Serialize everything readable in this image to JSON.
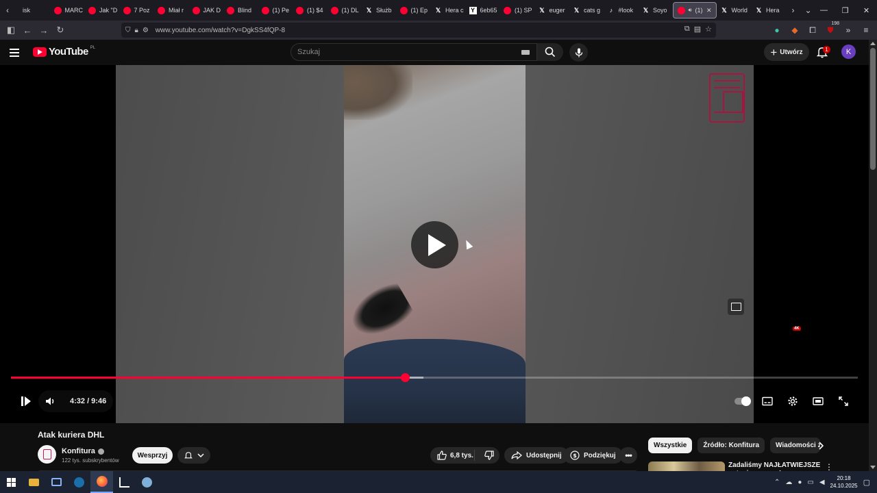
{
  "browser": {
    "tabs": [
      {
        "label": "isk",
        "favicon": "none"
      },
      {
        "label": "MARC",
        "favicon": "youtube"
      },
      {
        "label": "Jak \"D",
        "favicon": "youtube"
      },
      {
        "label": "7 Poz",
        "favicon": "youtube"
      },
      {
        "label": "Miał r",
        "favicon": "youtube"
      },
      {
        "label": "JAK D",
        "favicon": "youtube"
      },
      {
        "label": "Blind",
        "favicon": "youtube"
      },
      {
        "label": "(1) Pe",
        "favicon": "youtube"
      },
      {
        "label": "(1) $4",
        "favicon": "youtube"
      },
      {
        "label": "(1) DL",
        "favicon": "youtube"
      },
      {
        "label": "Służb",
        "favicon": "x"
      },
      {
        "label": "(1) Ep",
        "favicon": "youtube"
      },
      {
        "label": "Hera c",
        "favicon": "x"
      },
      {
        "label": "6eb65",
        "favicon": "y-square"
      },
      {
        "label": "(1) SP",
        "favicon": "youtube"
      },
      {
        "label": "euger",
        "favicon": "x"
      },
      {
        "label": "cats g",
        "favicon": "x"
      },
      {
        "label": "#look",
        "favicon": "tiktok"
      },
      {
        "label": "Soyo",
        "favicon": "x"
      },
      {
        "label": "(1)",
        "favicon": "youtube",
        "active": true
      },
      {
        "label": "World",
        "favicon": "x"
      },
      {
        "label": "Hera",
        "favicon": "x"
      }
    ],
    "url": "www.youtube.com/watch?v=DgkSS4fQP-8",
    "extension_badge": "198"
  },
  "youtube": {
    "logo_text": "YouTube",
    "region": "PL",
    "search_placeholder": "Szukaj",
    "create_label": "Utwórz",
    "notifications_count": "1",
    "avatar_letter": "K"
  },
  "player": {
    "current_time": "4:32",
    "duration": "9:46",
    "time_display": "4:32 / 9:46",
    "played_fraction": 0.465,
    "loaded_fraction": 0.487,
    "quality_badge": "4K"
  },
  "video": {
    "title": "Atak kuriera DHL",
    "channel_name": "Konfitura",
    "subscribers": "122 tys. subskrybentów",
    "support_label": "Wesprzyj",
    "likes": "6,8 tys.",
    "share_label": "Udostępnij",
    "thanks_label": "Podziękuj"
  },
  "sidebar": {
    "chips": [
      "Wszystkie",
      "Źródło: Konfitura",
      "Wiadomości ze"
    ],
    "recommendation_title": "Zadaliśmy NAJŁATWIEJSZE pytania na czas!"
  },
  "taskbar": {
    "time": "20:18",
    "date": "24.10.2025"
  },
  "colors": {
    "youtube_red": "#ff0033",
    "background": "#0f0f0f",
    "taskbar": "#1b2232"
  }
}
